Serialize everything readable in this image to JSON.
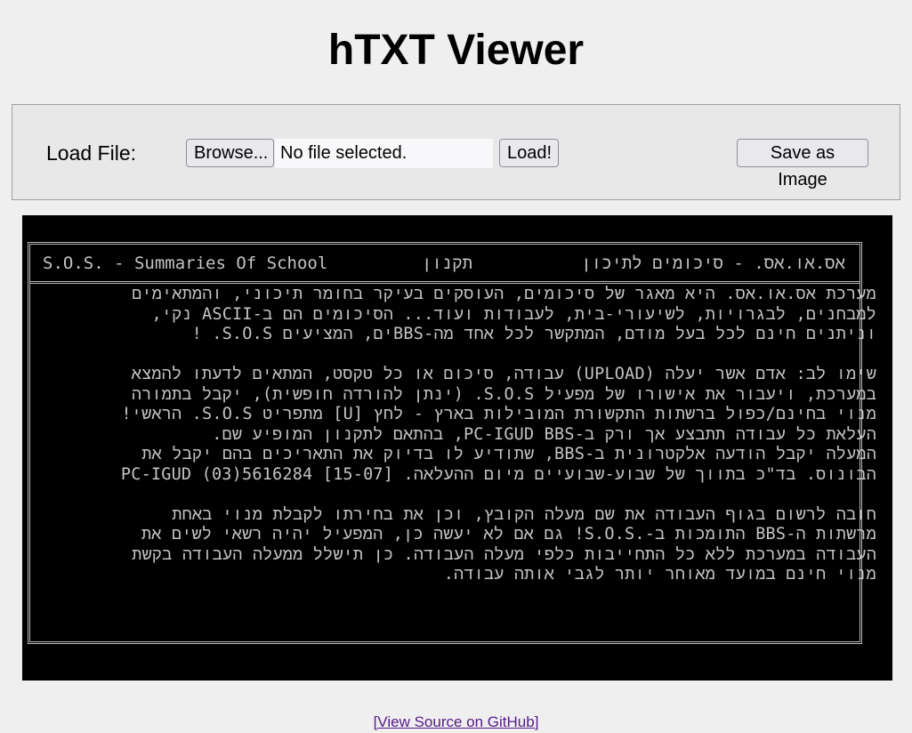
{
  "app": {
    "title": "hTXT Viewer"
  },
  "toolbar": {
    "load_label": "Load File:",
    "browse_label": "Browse...",
    "file_status": "No file selected.",
    "load_button": "Load!",
    "save_button": "Save as Image"
  },
  "viewer": {
    "header_left": "S.O.S. - Summaries Of School",
    "header_middle": "תקנון",
    "header_right": "אס.או.אס. - סיכומים לתיכון",
    "lines": [
      "מערכת אס.או.אס. היא מאגר של סיכומים, העוסקים בעיקר בחומר תיכוני, והמתאימים",
      "למבחנים, לבגרויות, לשיעורי-בית, לעבודות ועוד... הסיכומים הם ב-ASCII נקי,",
      "וניתנים חינם לכל בעל מודם, המתקשר לכל אחד מה-BBSים, המציעים S.O.S. !",
      "",
      "שימו לב: אדם אשר יעלה (UPLOAD) עבודה, סיכום או כל טקסט, המתאים לדעתו להמצא",
      "במערכת, ויעבור את אישורו של מפעיל S.O.S. (ינתן להורדה חופשית), יקבל בתמורה",
      "מנוי בחינם/כפול ברשתות התקשורת המובילות בארץ - לחץ [U] מתפריט S.O.S. הראשי!",
      "העלאת כל עבודה תתבצע אך ורק ב-PC-IGUD BBS, בהתאם לתקנון המופיע שם.",
      "המעלה יקבל הודעה אלקטרונית ב-BBS, שתודיע לו בדיוק את התאריכים בהם יקבל את",
      "הבונוס. בד\"כ בתווך של שבוע-שבועיים מיום ההעלאה. [15-07] 5616284(03) PC-IGUD",
      "",
      "חובה לרשום בגוף העבודה את שם מעלה הקובץ, וכן את בחירתו לקבלת מנוי באחת",
      "מרשתות ה-BBS התומכות ב-.S.O.S! גם אם לא יעשה כן, המפעיל יהיה רשאי לשים את",
      "העבודה במערכת ללא כל התחייבות כלפי מעלה העבודה. כן תישלל ממעלה העבודה בקשת",
      "מנוי חינם במועד מאוחר יותר לגבי אותה עבודה."
    ]
  },
  "footer": {
    "link_text": "[View Source on GitHub]"
  }
}
